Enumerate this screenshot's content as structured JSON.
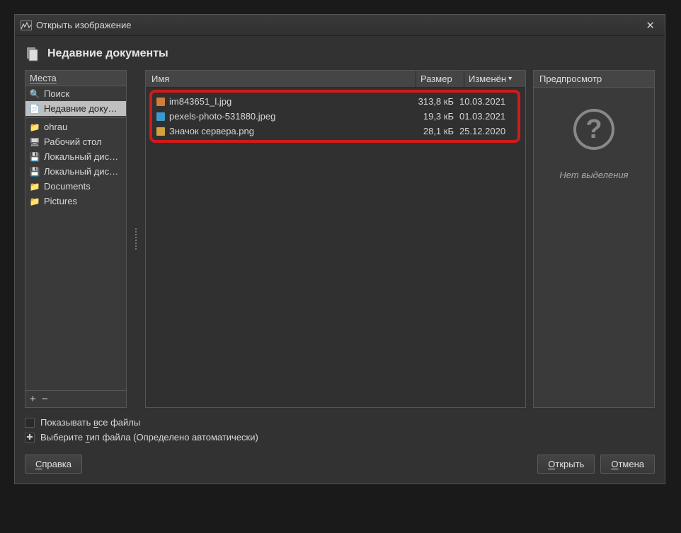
{
  "dialog": {
    "title": "Открыть изображение",
    "header": "Недавние документы"
  },
  "places": {
    "header_label": "Места",
    "items": [
      {
        "icon": "search-icon",
        "glyph": "🔍",
        "label": "Поиск",
        "selected": false
      },
      {
        "icon": "recent-icon",
        "glyph": "📄",
        "label": "Недавние доку…",
        "selected": true
      },
      {
        "icon": "folder-icon",
        "glyph": "📁",
        "label": "ohrau",
        "selected": false
      },
      {
        "icon": "desktop-icon",
        "glyph": "🖥",
        "label": "Рабочий стол",
        "selected": false
      },
      {
        "icon": "drive-icon",
        "glyph": "💾",
        "label": "Локальный дис…",
        "selected": false
      },
      {
        "icon": "drive-icon",
        "glyph": "💾",
        "label": "Локальный дис…",
        "selected": false
      },
      {
        "icon": "folder-icon",
        "glyph": "📁",
        "label": "Documents",
        "selected": false
      },
      {
        "icon": "folder-icon",
        "glyph": "📁",
        "label": "Pictures",
        "selected": false
      }
    ],
    "add_glyph": "+",
    "remove_glyph": "−"
  },
  "columns": {
    "name": "Имя",
    "size": "Размер",
    "modified": "Изменён"
  },
  "files": [
    {
      "icon": "image-file-icon",
      "icon_color": "#d07c3a",
      "name": "im843651_l.jpg",
      "size": "313,8 кБ",
      "date": "10.03.2021"
    },
    {
      "icon": "image-file-icon",
      "icon_color": "#3a9ad0",
      "name": "pexels-photo-531880.jpeg",
      "size": "19,3 кБ",
      "date": "01.03.2021"
    },
    {
      "icon": "image-file-icon",
      "icon_color": "#d0a23a",
      "name": "Значок сервера.png",
      "size": "28,1 кБ",
      "date": "25.12.2020"
    }
  ],
  "preview": {
    "header": "Предпросмотр",
    "no_selection": "Нет выделения"
  },
  "options": {
    "show_all_pre": "Показывать ",
    "show_all_ul": "в",
    "show_all_post": "се файлы",
    "filetype_pre": "Выберите ",
    "filetype_ul": "т",
    "filetype_post": "ип файла (Определено автоматически)",
    "expander_glyph": "✚"
  },
  "buttons": {
    "help_ul": "С",
    "help_post": "правка",
    "open_ul": "О",
    "open_post": "ткрыть",
    "cancel_ul": "О",
    "cancel_post": "тмена"
  }
}
